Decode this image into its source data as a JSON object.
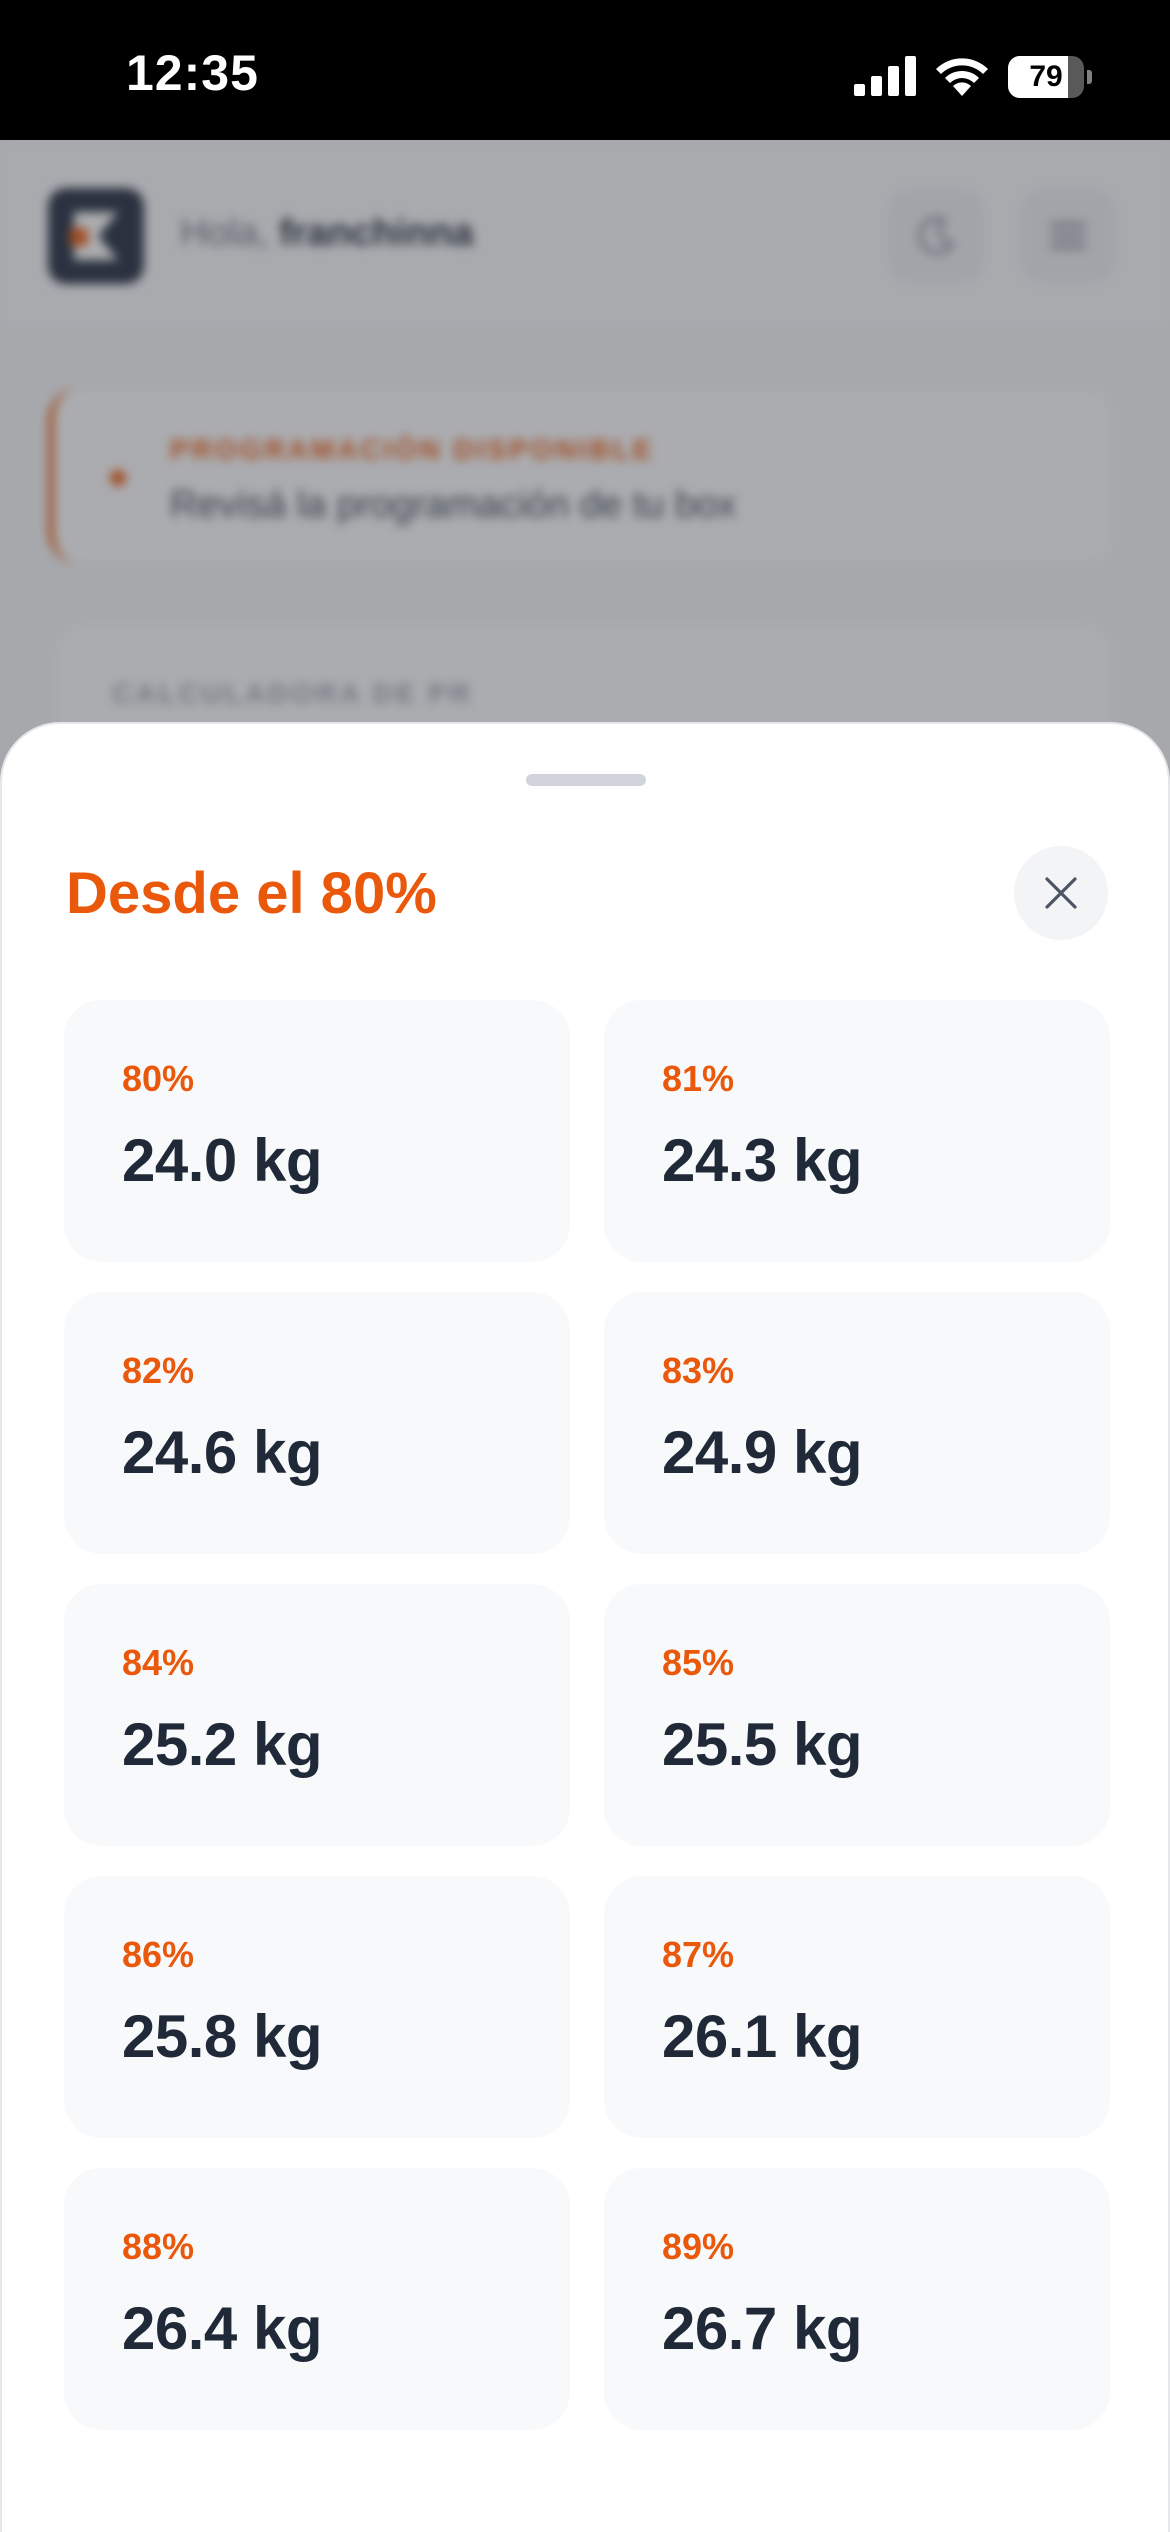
{
  "status_bar": {
    "time": "12:35",
    "battery_level": 79,
    "battery_label": "79",
    "icons": [
      "signal-icon",
      "wifi-icon",
      "battery-icon"
    ]
  },
  "background": {
    "greeting_prefix": "Hola,",
    "greeting_name": "franchinna",
    "notice_title": "PROGRAMACIÓN DISPONIBLE",
    "notice_subtitle": "Revisá la programación de tu box",
    "card_title": "CALCULADORA DE PR",
    "icons": [
      "logo-icon",
      "moon-icon",
      "menu-icon",
      "chevron-right-icon"
    ]
  },
  "sheet": {
    "title": "Desde el 80%",
    "close_icon": "close-icon",
    "items": [
      {
        "percent": "80%",
        "weight": "24.0 kg"
      },
      {
        "percent": "81%",
        "weight": "24.3 kg"
      },
      {
        "percent": "82%",
        "weight": "24.6 kg"
      },
      {
        "percent": "83%",
        "weight": "24.9 kg"
      },
      {
        "percent": "84%",
        "weight": "25.2 kg"
      },
      {
        "percent": "85%",
        "weight": "25.5 kg"
      },
      {
        "percent": "86%",
        "weight": "25.8 kg"
      },
      {
        "percent": "87%",
        "weight": "26.1 kg"
      },
      {
        "percent": "88%",
        "weight": "26.4 kg"
      },
      {
        "percent": "89%",
        "weight": "26.7 kg"
      }
    ]
  },
  "colors": {
    "accent": "#ea580c",
    "text_dark": "#1f2937",
    "card_bg": "#f8f9fb"
  }
}
